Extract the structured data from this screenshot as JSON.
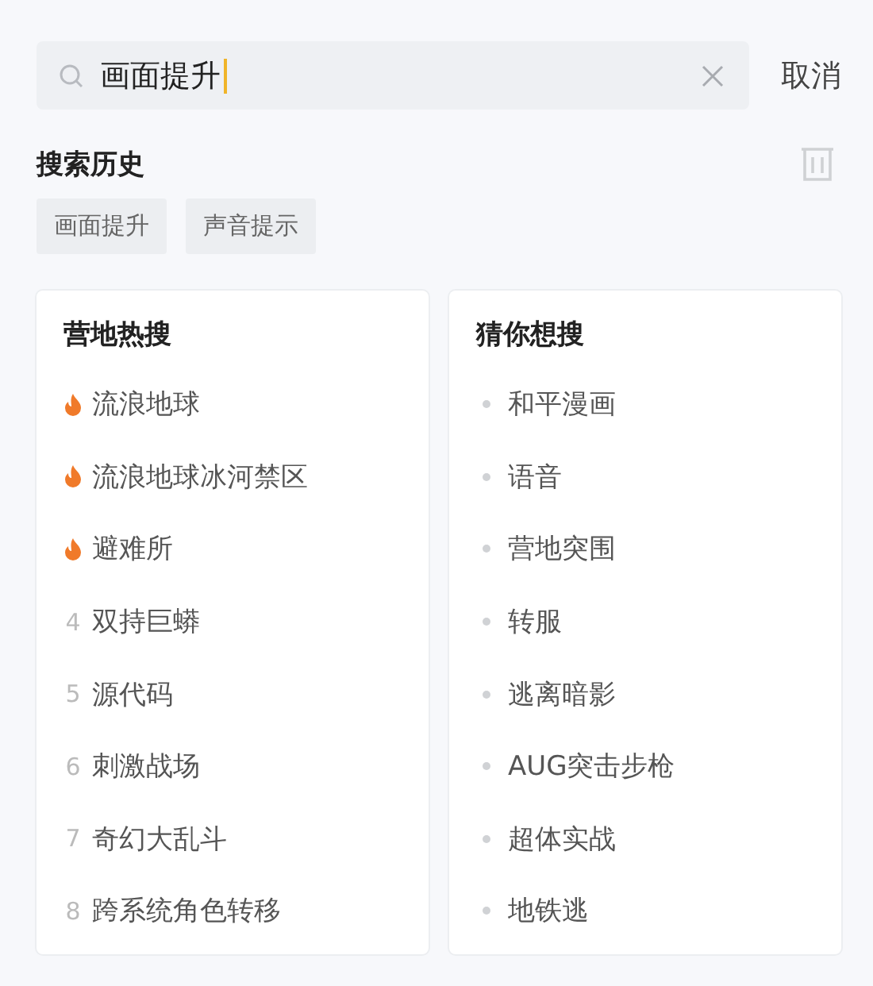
{
  "search": {
    "value": "画面提升",
    "cancel": "取消"
  },
  "history": {
    "title": "搜索历史",
    "chips": [
      "画面提升",
      "声音提示"
    ]
  },
  "hot": {
    "title": "营地热搜",
    "items": [
      {
        "kind": "hot",
        "text": "流浪地球"
      },
      {
        "kind": "hot",
        "text": "流浪地球冰河禁区"
      },
      {
        "kind": "hot",
        "text": "避难所"
      },
      {
        "kind": "rank",
        "rank": "4",
        "text": "双持巨蟒"
      },
      {
        "kind": "rank",
        "rank": "5",
        "text": "源代码"
      },
      {
        "kind": "rank",
        "rank": "6",
        "text": "刺激战场"
      },
      {
        "kind": "rank",
        "rank": "7",
        "text": "奇幻大乱斗"
      },
      {
        "kind": "rank",
        "rank": "8",
        "text": "跨系统角色转移"
      }
    ]
  },
  "guess": {
    "title": "猜你想搜",
    "items": [
      "和平漫画",
      "语音",
      "营地突围",
      "转服",
      "逃离暗影",
      "AUG突击步枪",
      "超体实战",
      "地铁逃"
    ]
  }
}
